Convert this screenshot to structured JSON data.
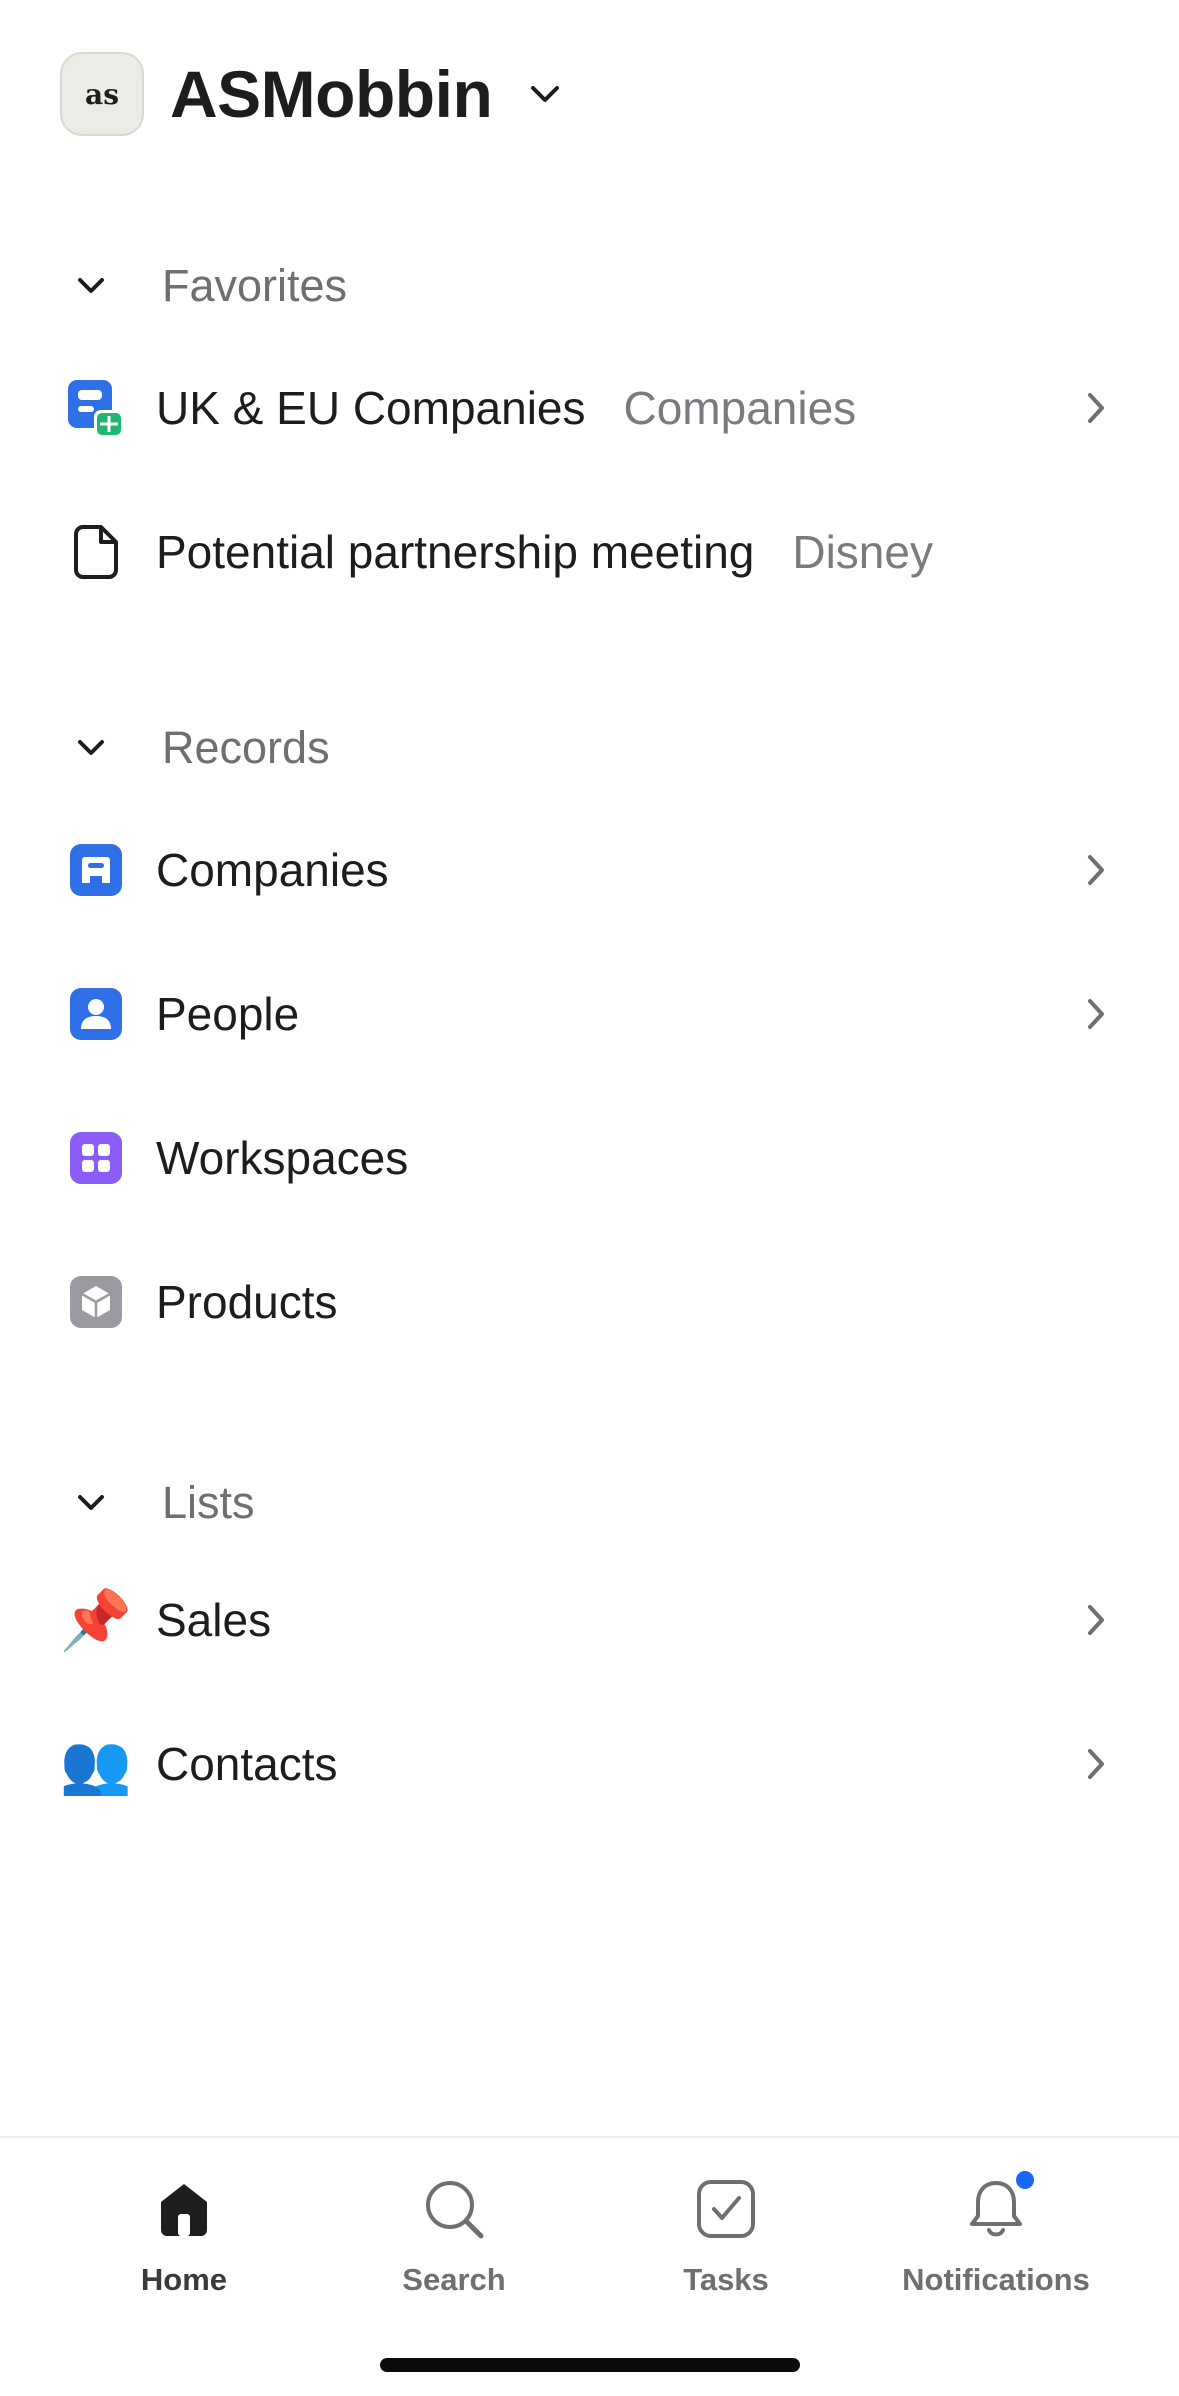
{
  "workspace": {
    "logo_text": "as",
    "name": "ASMobbin"
  },
  "sections": {
    "favorites": {
      "label": "Favorites",
      "items": [
        {
          "title": "UK & EU Companies",
          "meta": "Companies",
          "icon": "companies-list-icon"
        },
        {
          "title": "Potential partnership meeting",
          "meta": "Disney",
          "icon": "document-icon"
        }
      ]
    },
    "records": {
      "label": "Records",
      "items": [
        {
          "title": "Companies",
          "icon": "building-icon"
        },
        {
          "title": "People",
          "icon": "person-icon"
        },
        {
          "title": "Workspaces",
          "icon": "grid-icon"
        },
        {
          "title": "Products",
          "icon": "cube-icon"
        }
      ]
    },
    "lists": {
      "label": "Lists",
      "items": [
        {
          "title": "Sales",
          "emoji": "📌"
        },
        {
          "title": "Contacts",
          "emoji": "👥"
        }
      ]
    }
  },
  "tabbar": {
    "tabs": [
      {
        "label": "Home",
        "icon": "home-icon",
        "active": true
      },
      {
        "label": "Search",
        "icon": "search-icon"
      },
      {
        "label": "Tasks",
        "icon": "task-check-icon"
      },
      {
        "label": "Notifications",
        "icon": "bell-icon",
        "has_badge": true
      }
    ]
  },
  "colors": {
    "accent_blue": "#2f6fe8",
    "purple": "#8b5cf6",
    "gray_icon": "#9a9aa0",
    "green_badge": "#22b573",
    "notification_dot": "#1868f2"
  }
}
